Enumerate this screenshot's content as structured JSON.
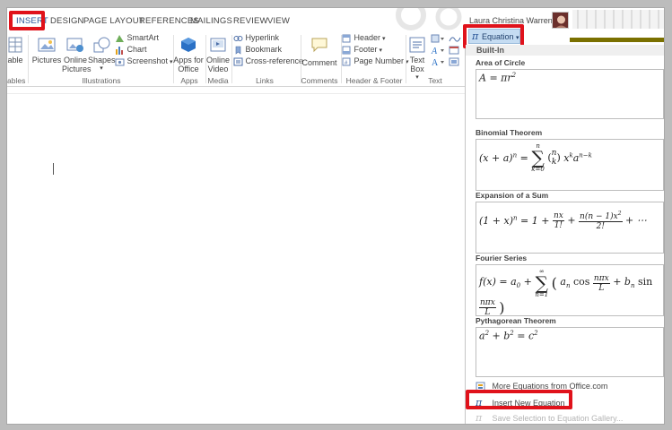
{
  "tabs": [
    {
      "label": "INSERT",
      "active": true
    },
    {
      "label": "DESIGN"
    },
    {
      "label": "PAGE LAYOUT"
    },
    {
      "label": "REFERENCES"
    },
    {
      "label": "MAILINGS"
    },
    {
      "label": "REVIEW"
    },
    {
      "label": "VIEW"
    }
  ],
  "user": {
    "name": "Laura Christina Warren"
  },
  "ribbon": {
    "table_label": "able",
    "tables_group": "ables",
    "pictures": "Pictures",
    "online_pictures_1": "Online",
    "online_pictures_2": "Pictures",
    "shapes": "Shapes",
    "smartart": "SmartArt",
    "chart": "Chart",
    "screenshot": "Screenshot",
    "illustrations_group": "Illustrations",
    "apps_1": "Apps for",
    "apps_2": "Office",
    "apps_group": "Apps",
    "online_video_1": "Online",
    "online_video_2": "Video",
    "media_group": "Media",
    "hyperlink": "Hyperlink",
    "bookmark": "Bookmark",
    "cross_reference": "Cross-reference",
    "links_group": "Links",
    "comment": "Comment",
    "comments_group": "Comments",
    "header": "Header",
    "footer": "Footer",
    "page_number": "Page Number",
    "header_footer_group": "Header & Footer",
    "text_box_1": "Text",
    "text_box_2": "Box",
    "text_group": "Text"
  },
  "gallery": {
    "button_label": "Equation",
    "section_label": "Built-In",
    "equations": [
      {
        "title": "Area of Circle"
      },
      {
        "title": "Binomial Theorem"
      },
      {
        "title": "Expansion of a Sum"
      },
      {
        "title": "Fourier Series"
      },
      {
        "title": "Pythagorean Theorem"
      }
    ],
    "more_equations": "More Equations from Office.com",
    "insert_new": "Insert New Equation",
    "save_selection": "Save Selection to Equation Gallery..."
  },
  "colors": {
    "accent": "#2b579a",
    "highlight": "#e0121b",
    "button_fill": "#c5dcf2"
  }
}
